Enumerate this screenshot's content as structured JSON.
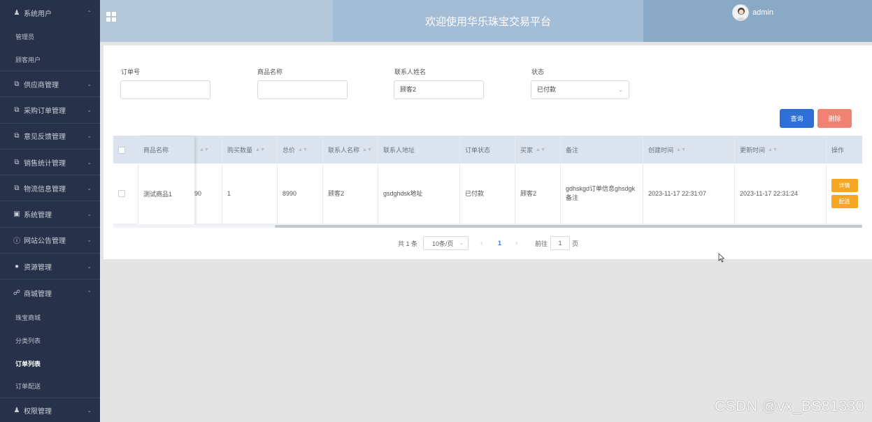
{
  "sidebar": {
    "items": [
      {
        "label": "系统用户",
        "icon": "user-icon",
        "expanded": true,
        "children": [
          "管理员",
          "顾客用户"
        ]
      },
      {
        "label": "供应商管理",
        "icon": "external-link-icon"
      },
      {
        "label": "采购订单管理",
        "icon": "external-link-icon"
      },
      {
        "label": "意见反馈管理",
        "icon": "external-link-icon"
      },
      {
        "label": "销售统计管理",
        "icon": "external-link-icon"
      },
      {
        "label": "物流信息管理",
        "icon": "external-link-icon"
      },
      {
        "label": "系统管理",
        "icon": "image-icon"
      },
      {
        "label": "网站公告管理",
        "icon": "info-icon"
      },
      {
        "label": "资源管理",
        "icon": "location-pin-icon"
      },
      {
        "label": "商城管理",
        "icon": "cart-icon",
        "expanded": true,
        "children": [
          "珠宝商城",
          "分类列表",
          "订单列表",
          "订单配送"
        ],
        "active_child": "订单列表"
      },
      {
        "label": "权限管理",
        "icon": "user-icon"
      }
    ]
  },
  "header": {
    "title": "欢迎使用华乐珠宝交易平台",
    "username": "admin",
    "colors": {
      "left": "#b4c7d8",
      "middle": "#a3bdd7",
      "right": "#89a9c7"
    }
  },
  "filters": {
    "order_no": {
      "label": "订单号",
      "value": ""
    },
    "product_name": {
      "label": "商品名称",
      "value": ""
    },
    "contact_name": {
      "label": "联系人姓名",
      "value": "顾客2"
    },
    "status": {
      "label": "状态",
      "value": "已付款"
    }
  },
  "buttons": {
    "query": "查询",
    "delete": "删除"
  },
  "table": {
    "headers": {
      "product_name": "商品名称",
      "purchase_qty": "购买数量",
      "total": "总价",
      "contact_name": "联系人名称",
      "contact_address": "联系人地址",
      "order_status": "订单状态",
      "buyer": "买家",
      "remark": "备注",
      "created_at": "创建时间",
      "updated_at": "更新时间",
      "actions": "操作"
    },
    "rows": [
      {
        "product_name": "测试商品1",
        "partial_price": "90",
        "purchase_qty": "1",
        "total": "8990",
        "contact_name": "顾客2",
        "contact_address": "gsdghdsk地址",
        "order_status": "已付款",
        "buyer": "顾客2",
        "remark": "gdhskgd订单信息ghsdgk备注",
        "created_at": "2023-11-17 22:31:07",
        "updated_at": "2023-11-17 22:31:24",
        "detail_btn": "详情",
        "ship_btn": "配送"
      }
    ]
  },
  "pagination": {
    "total_text": "共 1 条",
    "page_size": "10条/页",
    "current_page": "1",
    "goto_label": "前往",
    "goto_value": "1",
    "page_suffix": "页"
  },
  "watermark": "CSDN @vx_BS81330"
}
